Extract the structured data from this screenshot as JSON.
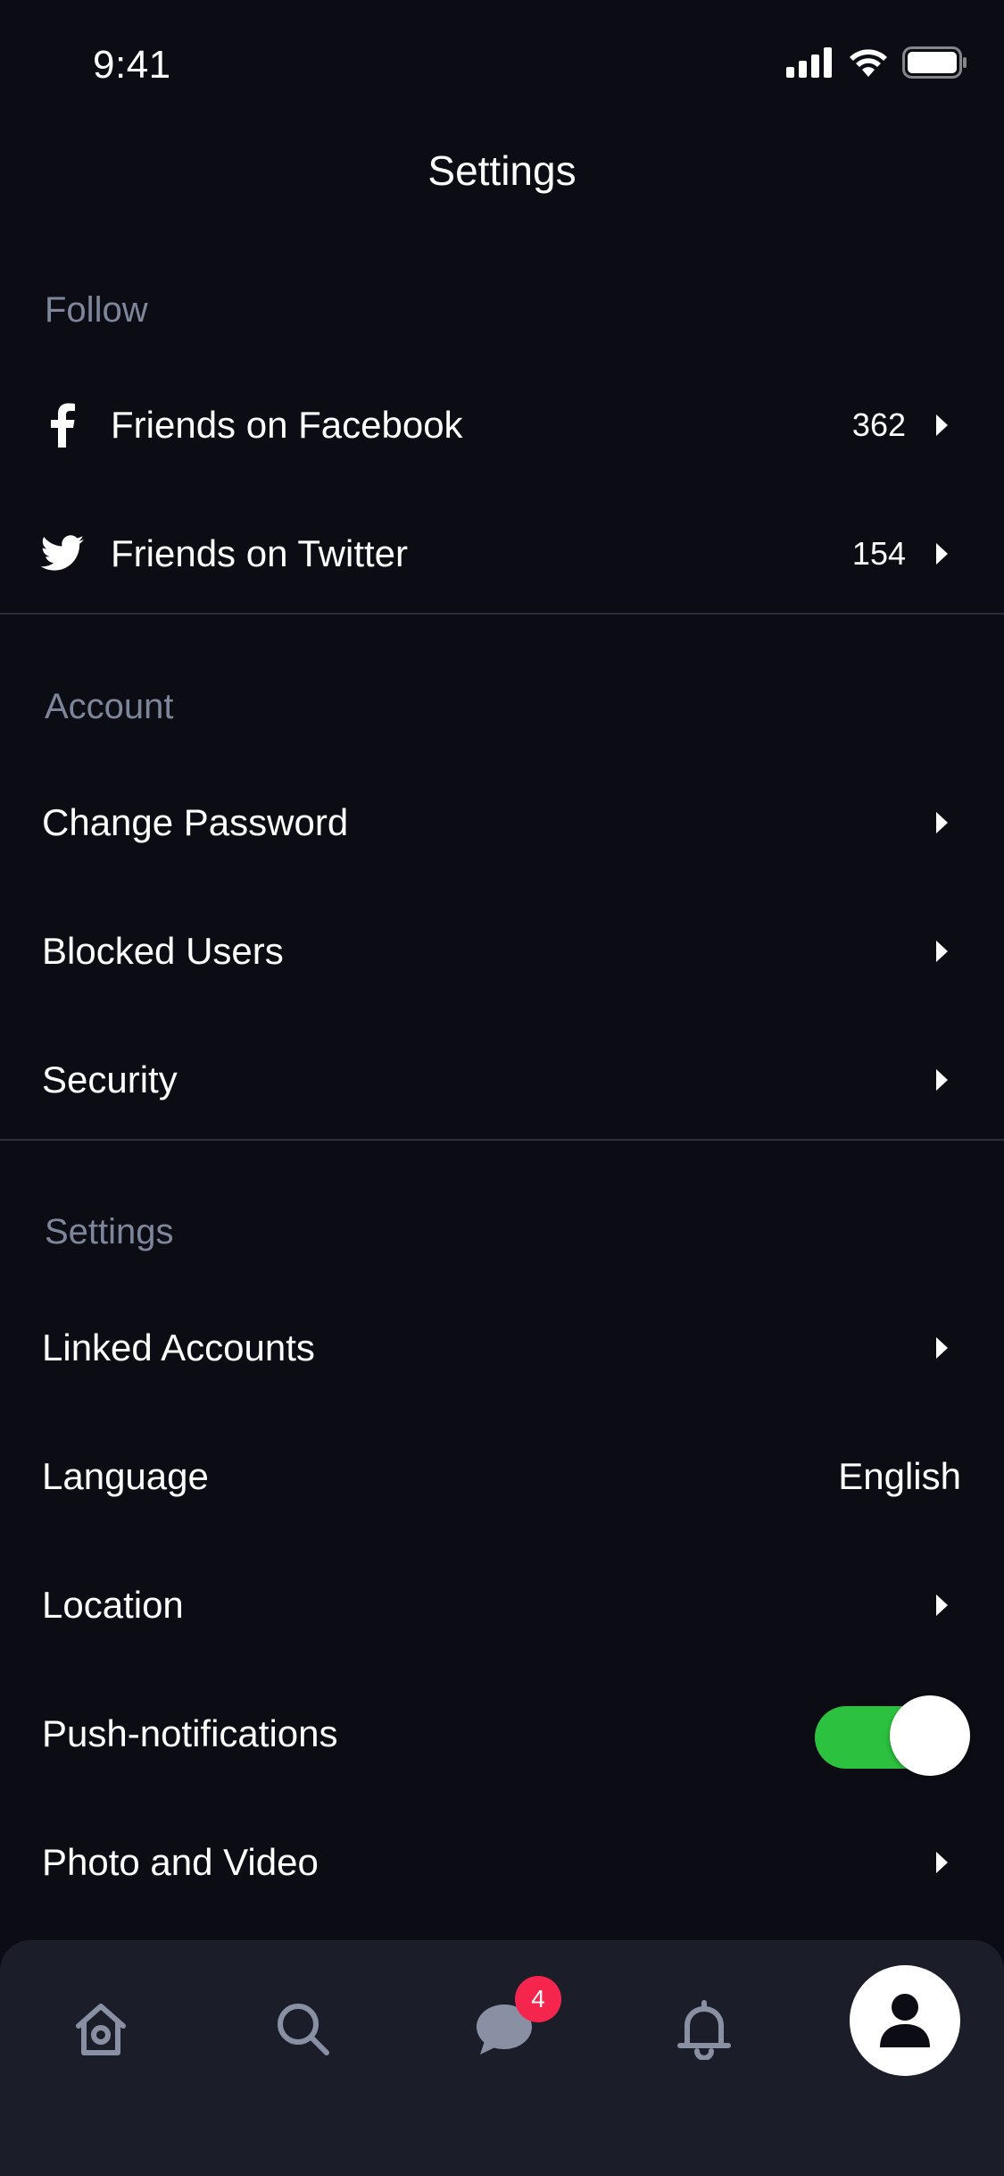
{
  "status_bar": {
    "time": "9:41"
  },
  "header": {
    "title": "Settings"
  },
  "sections": {
    "follow": {
      "header": "Follow",
      "rows": [
        {
          "label": "Friends on Facebook",
          "value": "362",
          "icon": "facebook-icon"
        },
        {
          "label": "Friends on Twitter",
          "value": "154",
          "icon": "twitter-icon"
        }
      ]
    },
    "account": {
      "header": "Account",
      "rows": [
        {
          "label": "Change Password"
        },
        {
          "label": "Blocked Users"
        },
        {
          "label": "Security"
        }
      ]
    },
    "settings": {
      "header": "Settings",
      "rows": [
        {
          "label": "Linked Accounts"
        },
        {
          "label": "Language",
          "value": "English"
        },
        {
          "label": "Location"
        },
        {
          "label": "Push-notifications",
          "toggle": true
        },
        {
          "label": "Photo and Video"
        }
      ]
    }
  },
  "tab_bar": {
    "tabs": [
      {
        "name": "home",
        "icon": "home-icon"
      },
      {
        "name": "search",
        "icon": "search-icon"
      },
      {
        "name": "messages",
        "icon": "chat-icon",
        "badge": "4"
      },
      {
        "name": "notifications",
        "icon": "bell-icon"
      },
      {
        "name": "profile",
        "icon": "profile-icon",
        "active": true
      }
    ]
  },
  "colors": {
    "background": "#0c0d14",
    "section_header": "#7e869b",
    "toggle_on": "#2cc23f",
    "badge": "#f5254e",
    "tab_bar": "#1b1d29"
  }
}
